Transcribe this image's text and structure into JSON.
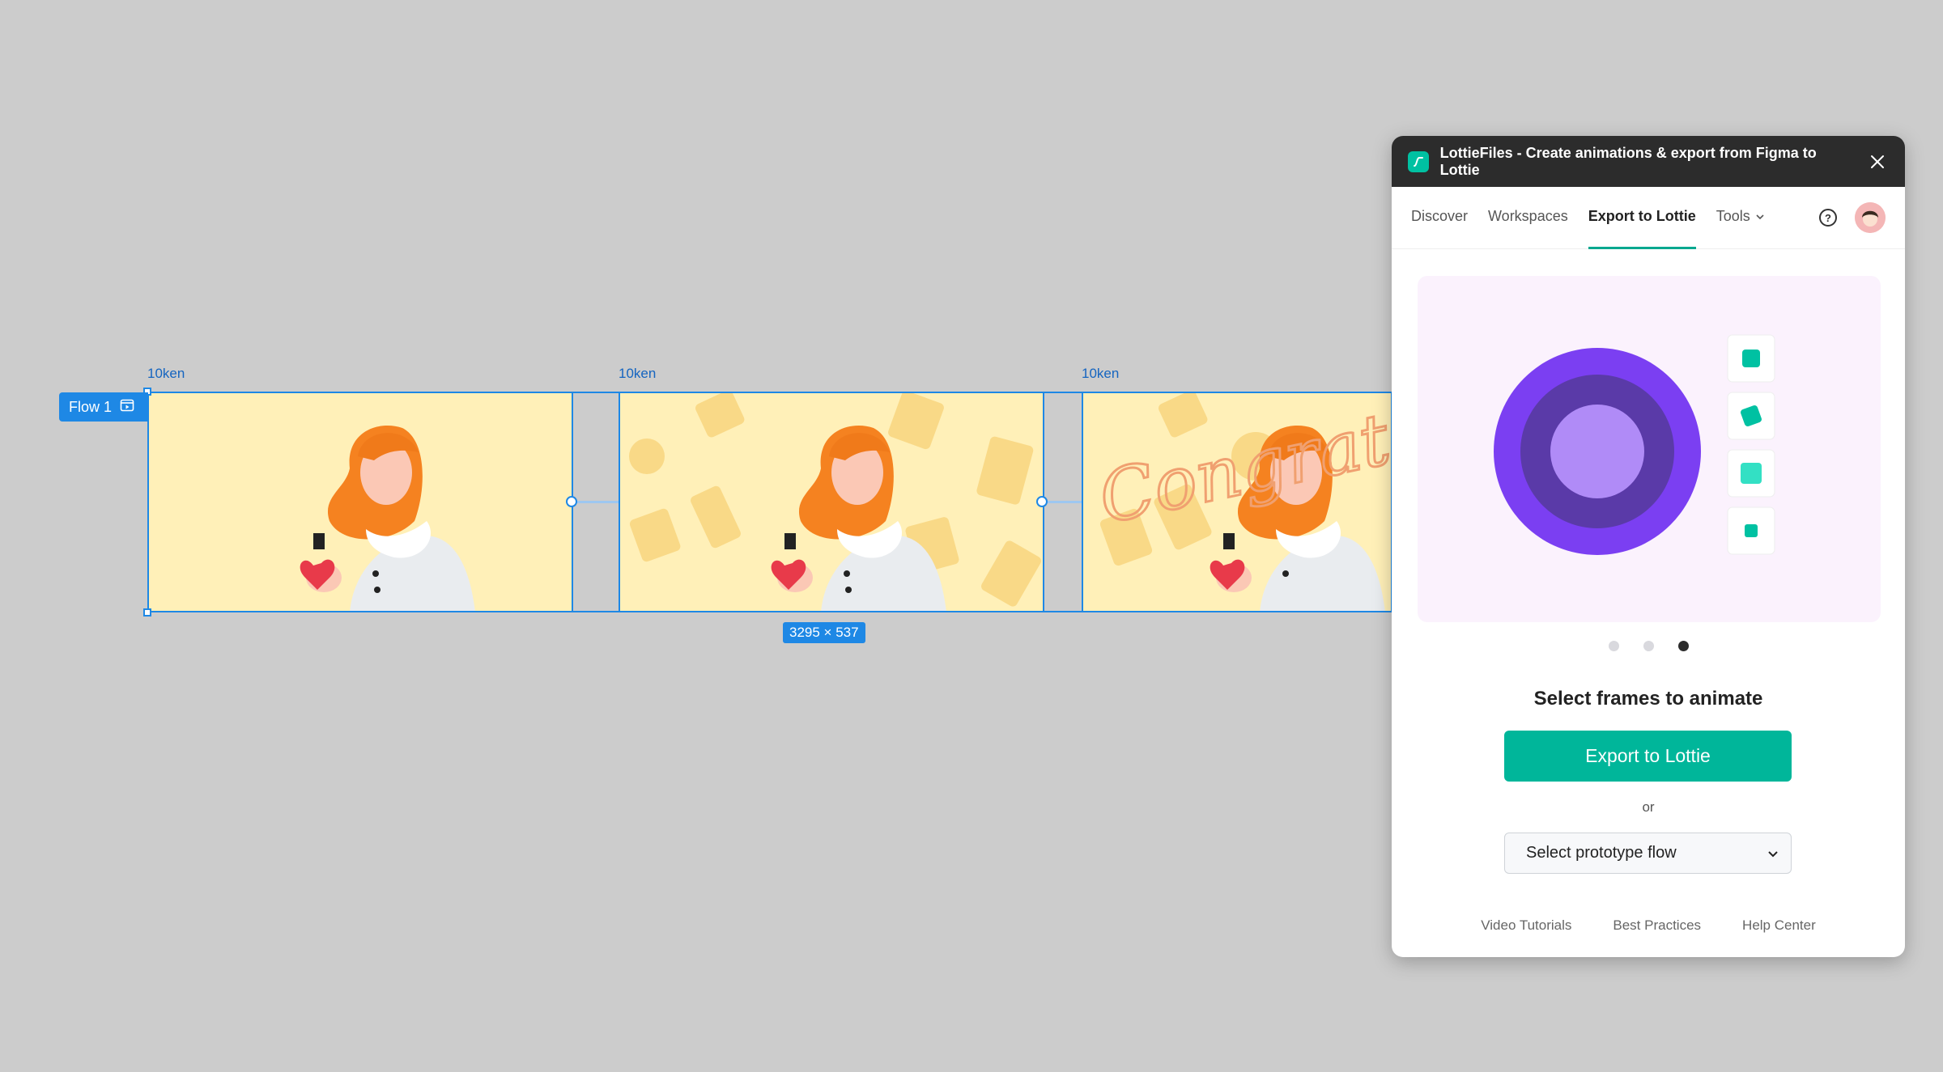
{
  "canvas": {
    "frame_labels": [
      "10ken",
      "10ken",
      "10ken"
    ],
    "flow_label": "Flow 1",
    "size_badge": "3295 × 537",
    "frame3_text": "Congrats!"
  },
  "panel": {
    "title": "LottieFiles - Create animations & export from Figma to Lottie",
    "tabs": [
      {
        "label": "Discover"
      },
      {
        "label": "Workspaces"
      },
      {
        "label": "Export to Lottie"
      },
      {
        "label": "Tools"
      }
    ],
    "help_glyph": "?",
    "section_title": "Select frames to animate",
    "primary_button": "Export to Lottie",
    "or_text": "or",
    "select_value": "Select prototype flow",
    "footer_links": [
      "Video Tutorials",
      "Best Practices",
      "Help Center"
    ],
    "colors": {
      "accent": "#00b69a",
      "selection": "#1e88e5",
      "purple_outer": "#7b3ff2",
      "purple_mid": "#5a3aa8",
      "purple_inner": "#b08bf7"
    }
  }
}
